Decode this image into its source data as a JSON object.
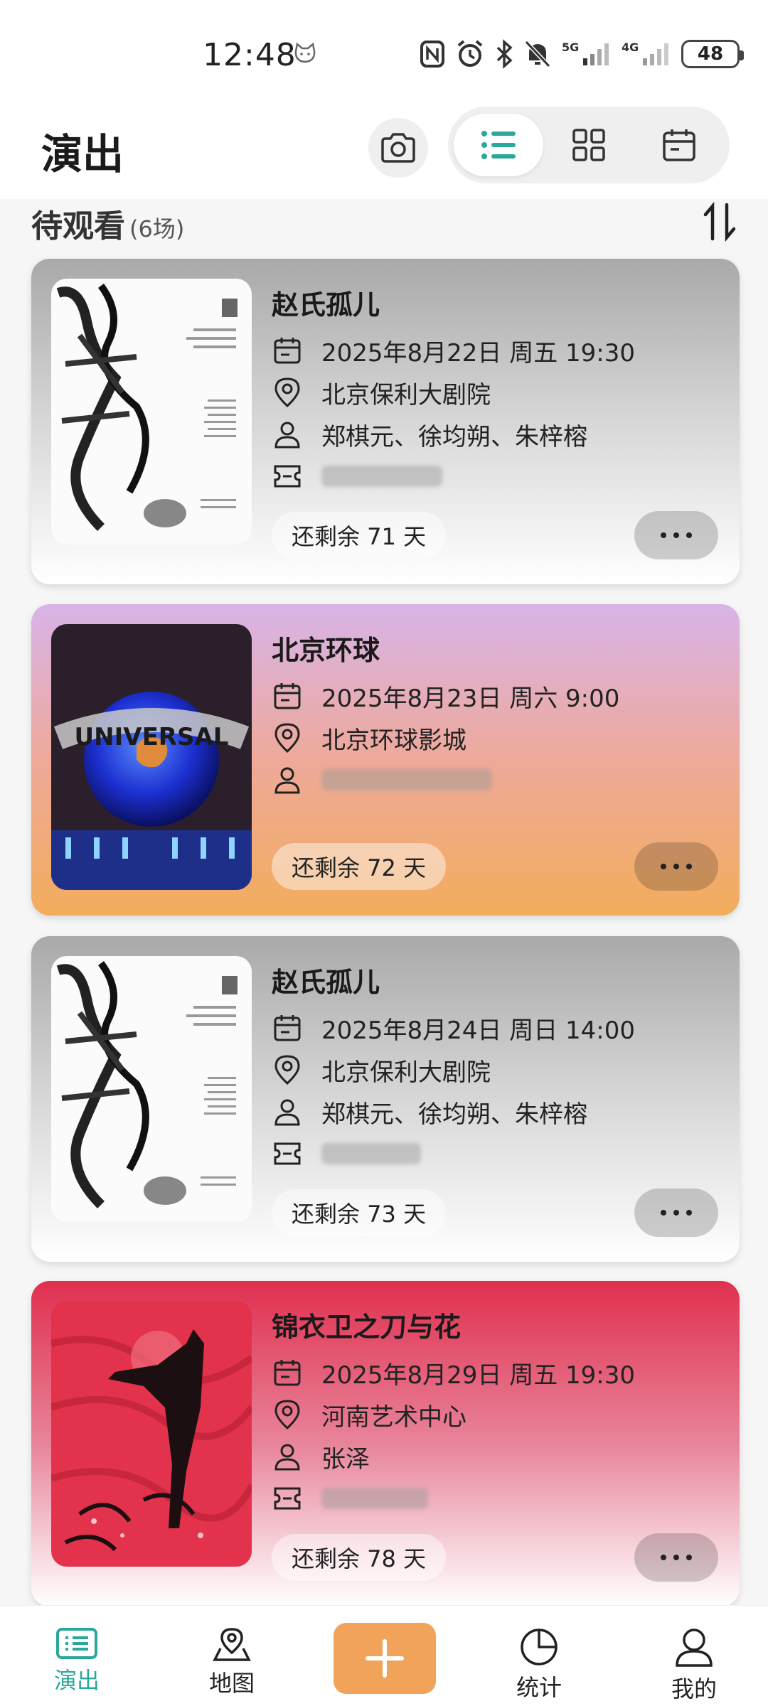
{
  "status_bar": {
    "time": "12:48",
    "network_1": "5G",
    "network_2": "4G",
    "battery": "48"
  },
  "header": {
    "title": "演出"
  },
  "section": {
    "title": "待观看",
    "count": "(6场)"
  },
  "cards": [
    {
      "title": "赵氏孤儿",
      "datetime": "2025年8月22日 周五 19:30",
      "venue": "北京保利大剧院",
      "cast": "郑棋元、徐均朔、朱梓榕",
      "remaining": "还剩余 71 天",
      "theme": "gray",
      "poster": "zhao-poster"
    },
    {
      "title": "北京环球",
      "datetime": "2025年8月23日 周六 9:00",
      "venue": "北京环球影城",
      "remaining": "还剩余 72 天",
      "theme": "purple",
      "poster": "universal-poster",
      "poster_text": "UNIVERSAL"
    },
    {
      "title": "赵氏孤儿",
      "datetime": "2025年8月24日 周日 14:00",
      "venue": "北京保利大剧院",
      "cast": "郑棋元、徐均朔、朱梓榕",
      "remaining": "还剩余 73 天",
      "theme": "gray",
      "poster": "zhao-poster"
    },
    {
      "title": "锦衣卫之刀与花",
      "datetime": "2025年8月29日 周五 19:30",
      "venue": "河南艺术中心",
      "cast": "张泽",
      "remaining": "还剩余 78 天",
      "theme": "red",
      "poster": "jinyiwei-poster"
    }
  ],
  "bottom_nav": {
    "items": [
      {
        "label": "演出",
        "icon": "list-icon",
        "active": true
      },
      {
        "label": "地图",
        "icon": "map-pin-icon"
      },
      {
        "label": "统计",
        "icon": "pie-chart-icon"
      },
      {
        "label": "我的",
        "icon": "user-icon"
      }
    ],
    "add_icon": "plus-icon"
  },
  "colors": {
    "accent": "#2aa89a",
    "add_button": "#f2a35a"
  }
}
